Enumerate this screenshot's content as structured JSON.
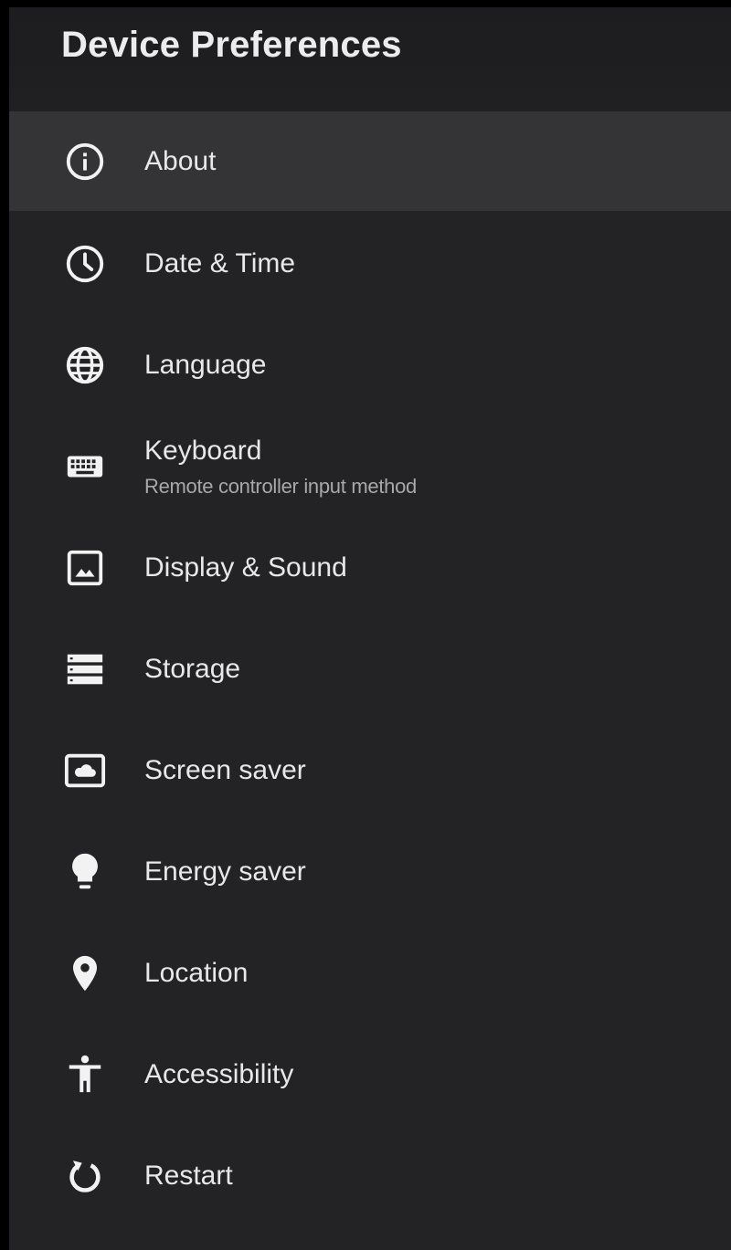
{
  "header": {
    "title": "Device Preferences"
  },
  "menu": {
    "items": [
      {
        "label": "About",
        "icon": "info-icon",
        "focused": true
      },
      {
        "label": "Date & Time",
        "icon": "clock-icon"
      },
      {
        "label": "Language",
        "icon": "globe-icon"
      },
      {
        "label": "Keyboard",
        "sublabel": "Remote controller input method",
        "icon": "keyboard-icon"
      },
      {
        "label": "Display & Sound",
        "icon": "image-icon"
      },
      {
        "label": "Storage",
        "icon": "storage-icon"
      },
      {
        "label": "Screen saver",
        "icon": "screensaver-icon"
      },
      {
        "label": "Energy saver",
        "icon": "lightbulb-icon"
      },
      {
        "label": "Location",
        "icon": "location-pin-icon"
      },
      {
        "label": "Accessibility",
        "icon": "accessibility-icon"
      },
      {
        "label": "Restart",
        "icon": "restart-icon"
      }
    ]
  },
  "colors": {
    "background": "#232325",
    "header_background": "#1f1f21",
    "focused_row": "#343436",
    "text_primary": "#e8e8e8",
    "text_secondary": "#a8a8a8"
  }
}
